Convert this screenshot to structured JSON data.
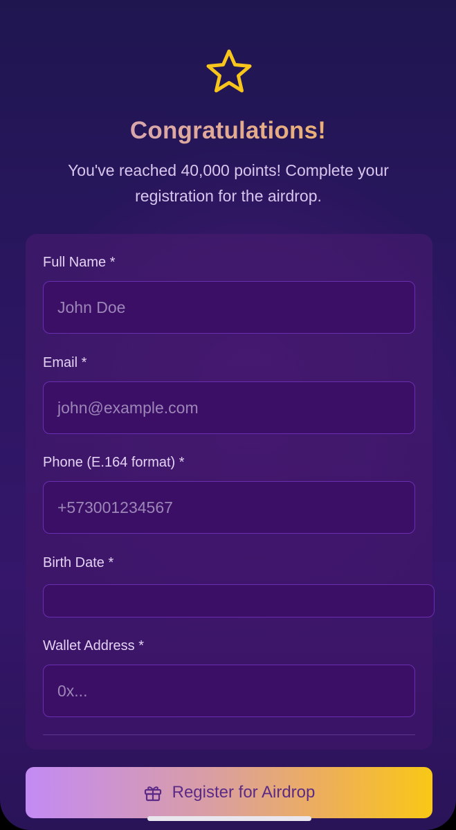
{
  "header": {
    "icon": "star-outline-icon",
    "title": "Congratulations!",
    "subtitle": "You've reached 40,000 points! Complete your registration for the airdrop."
  },
  "form": {
    "full_name": {
      "label": "Full Name *",
      "placeholder": "John Doe"
    },
    "email": {
      "label": "Email *",
      "placeholder": "john@example.com"
    },
    "phone": {
      "label": "Phone (E.164 format) *",
      "placeholder": "+573001234567"
    },
    "birth_date": {
      "label": "Birth Date *",
      "value": ""
    },
    "wallet": {
      "label": "Wallet Address *",
      "placeholder": "0x..."
    }
  },
  "submit": {
    "label": "Register for Airdrop",
    "icon": "gift-icon"
  },
  "colors": {
    "accent_gold": "#f6b84a",
    "accent_purple": "#c38af5",
    "input_border": "#6a2fb0"
  }
}
